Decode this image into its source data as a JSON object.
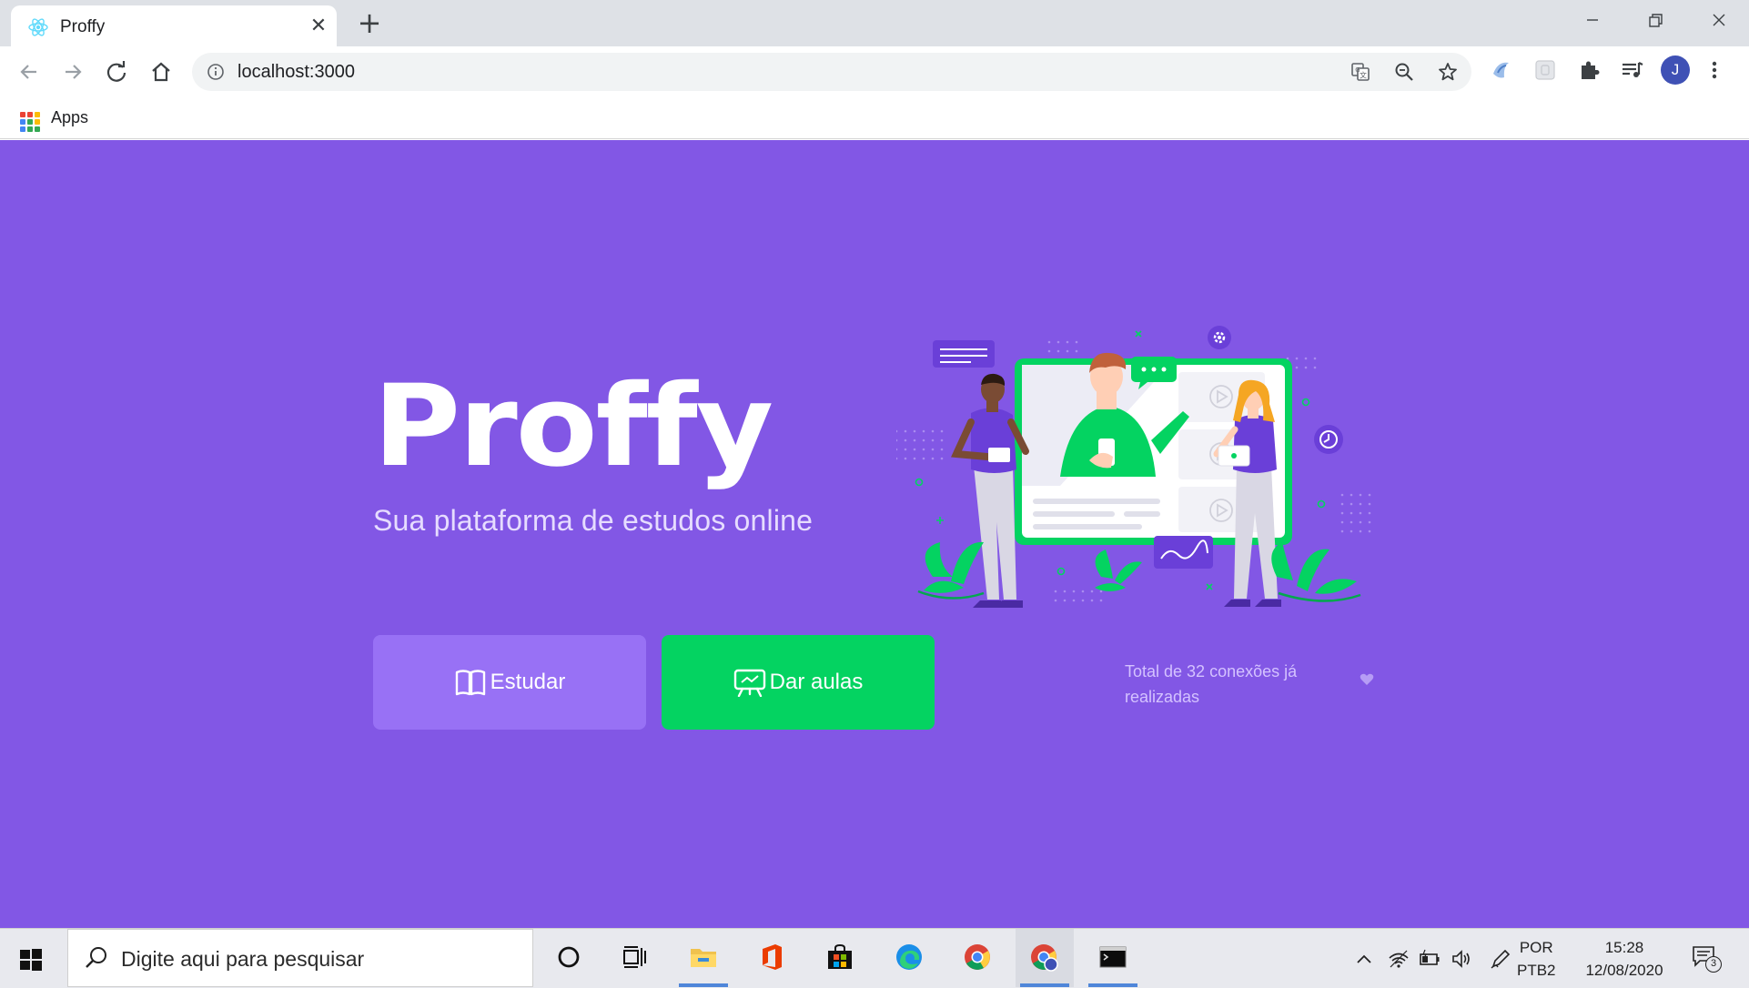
{
  "browser": {
    "tab": {
      "title": "Proffy",
      "favicon": "react-atom-icon",
      "close_icon": "close-icon"
    },
    "new_tab_icon": "plus-icon",
    "window_controls": [
      "minimize-icon",
      "restore-icon",
      "close-icon"
    ],
    "nav": [
      "back-arrow-icon",
      "forward-arrow-icon",
      "reload-icon",
      "home-icon"
    ],
    "address_bar": {
      "url": "localhost:3000",
      "info_icon": "info-icon"
    },
    "omnibox_icons": [
      "translate-icon",
      "zoom-out-icon",
      "star-icon"
    ],
    "extensions": [
      "extension-blue-icon",
      "extension-gray-icon",
      "puzzle-icon",
      "media-queue-icon"
    ],
    "profile_initial": "J",
    "menu_icon": "kebab-menu-icon",
    "bookmarks": {
      "apps_label": "Apps",
      "apps_icon": "apps-grid-icon"
    }
  },
  "page": {
    "logo_text": "Proffy",
    "tagline": "Sua plataforma de estudos online",
    "buttons": {
      "study": {
        "label": "Estudar",
        "icon": "open-book-icon"
      },
      "give_classes": {
        "label": "Dar aulas",
        "icon": "presentation-board-icon"
      }
    },
    "connections_text": "Total de 32 conexões já realizadas",
    "heart_icon": "heart-icon",
    "colors": {
      "background": "#8257e5",
      "study_button": "#9871f5",
      "give_button": "#04d361",
      "tagline": "#e6dcff"
    }
  },
  "taskbar": {
    "start_icon": "windows-logo-icon",
    "search_placeholder": "Digite aqui para pesquisar",
    "apps": [
      "cortana-icon",
      "task-view-icon",
      "file-explorer-icon",
      "office-icon",
      "store-icon",
      "edge-icon",
      "chrome-icon",
      "chrome-profile-icon",
      "terminal-icon"
    ],
    "tray": [
      "chevron-up-icon",
      "wifi-icon",
      "battery-icon",
      "volume-icon",
      "pen-icon"
    ],
    "language": {
      "line1": "POR",
      "line2": "PTB2"
    },
    "clock": {
      "time": "15:28",
      "date": "12/08/2020"
    },
    "notifications": {
      "count": "3",
      "icon": "notification-icon"
    }
  }
}
